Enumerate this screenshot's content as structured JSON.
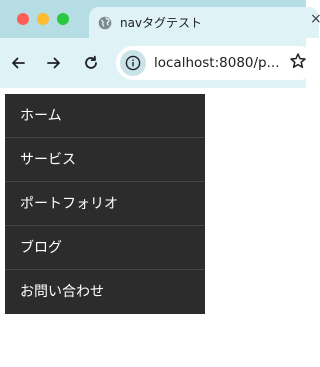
{
  "browser": {
    "tab": {
      "title": "navタグテスト",
      "favicon": "globe-icon",
      "close": "×"
    },
    "toolbar": {
      "back_icon": "arrow-left-icon",
      "forward_icon": "arrow-right-icon",
      "reload_icon": "reload-icon",
      "site_info_icon": "info-icon",
      "url": "localhost:8080/p...",
      "bookmark_icon": "star-icon"
    },
    "colors": {
      "tabstrip": "#b6dde4",
      "toolbar": "#dff2f5"
    }
  },
  "nav": {
    "background": "#2c2c2c",
    "items": [
      {
        "label": "ホーム"
      },
      {
        "label": "サービス"
      },
      {
        "label": "ポートフォリオ"
      },
      {
        "label": "ブログ"
      },
      {
        "label": "お問い合わせ"
      }
    ]
  }
}
